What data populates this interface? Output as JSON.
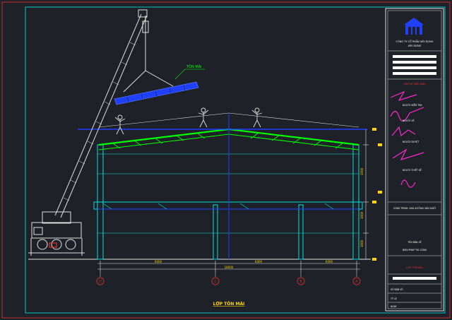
{
  "drawing": {
    "main_title": "LỢP TÔN MÁI",
    "panel_label": "TÔN MÁI"
  },
  "title_block": {
    "company": "CÔNG TY CỔ PHẦN XÂY DỰNG",
    "company_sub": "XÂY DỰNG",
    "signature_header": "CHỮ KÝ ĐẦU MÀU",
    "roles": [
      "NGƯỜI KIỂM TRA",
      "NGƯỜI VẼ",
      "NGƯỜI DUYỆT",
      "NGƯỜI THIẾT KẾ"
    ],
    "project_line": "CÔNG TRÌNH: NHÀ XƯỞNG SẢN XUẤT",
    "drawing_name_label": "TÊN BẢN VẼ",
    "drawing_name": "BIỆN PHÁP THI CÔNG",
    "sheet_title": "LỢP TÔN MÁI",
    "footer_lines": [
      "SỐ BẢN VẼ",
      "TỶ LỆ",
      "NGÀY"
    ]
  },
  "dimensions": {
    "spans": [
      "6000",
      "6000",
      "6000"
    ],
    "total": "18000",
    "heights": [
      "3000",
      "3000",
      "3000"
    ]
  },
  "grid_axes": [
    "D",
    "C",
    "B",
    "A"
  ],
  "colors": {
    "background": "#1e2228",
    "frame": "#00c8c8",
    "roof": "#00ff00",
    "steel": "#00e0e0",
    "purlin": "#2040ff",
    "outer_border": "#c03030",
    "label_yellow": "#ffd400",
    "signature": "#ff2ad0",
    "title_red": "#ff3030"
  }
}
